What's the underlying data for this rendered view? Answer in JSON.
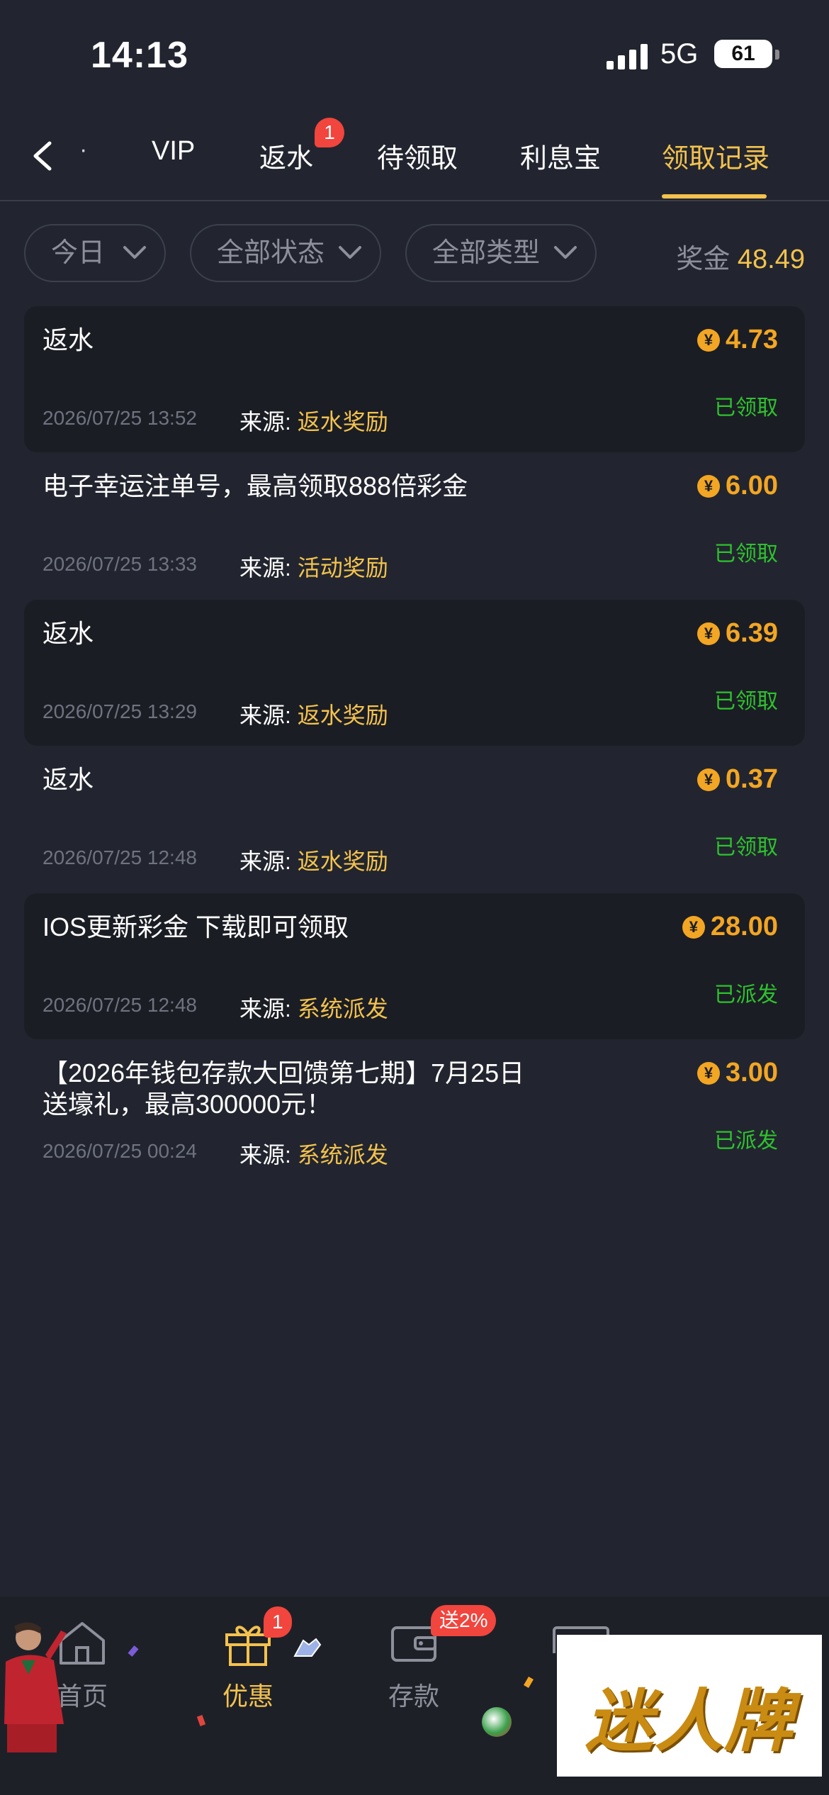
{
  "status_bar": {
    "time": "14:13",
    "network": "5G",
    "battery": "61"
  },
  "tabs": [
    {
      "label": "VIP"
    },
    {
      "label": "返水",
      "badge": "1"
    },
    {
      "label": "待领取"
    },
    {
      "label": "利息宝"
    },
    {
      "label": "领取记录",
      "active": true
    }
  ],
  "filters": {
    "date": "今日",
    "status": "全部状态",
    "type": "全部类型"
  },
  "bonus": {
    "label": "奖金",
    "amount": "48.49"
  },
  "source_label": "来源:",
  "currency_icon": "¥",
  "records": [
    {
      "title": "返水",
      "amount": "4.73",
      "time": "2026/07/25 13:52",
      "source": "返水奖励",
      "status": "已领取"
    },
    {
      "title": "电子幸运注单号，最高领取888倍彩金",
      "amount": "6.00",
      "time": "2026/07/25 13:33",
      "source": "活动奖励",
      "status": "已领取"
    },
    {
      "title": "返水",
      "amount": "6.39",
      "time": "2026/07/25 13:29",
      "source": "返水奖励",
      "status": "已领取"
    },
    {
      "title": "返水",
      "amount": "0.37",
      "time": "2026/07/25 12:48",
      "source": "返水奖励",
      "status": "已领取"
    },
    {
      "title": "IOS更新彩金  下载即可领取",
      "amount": "28.00",
      "time": "2026/07/25 12:48",
      "source": "系统派发",
      "status": "已派发"
    },
    {
      "title": "【2026年钱包存款大回馈第七期】7月25日送壕礼，最高300000元！",
      "amount": "3.00",
      "time": "2026/07/25 00:24",
      "source": "系统派发",
      "status": "已派发"
    }
  ],
  "bottom_nav": {
    "home": "首页",
    "promo": "优惠",
    "promo_badge": "1",
    "deposit": "存款",
    "deposit_badge": "送2%"
  },
  "logo": "迷人牌",
  "colors": {
    "accent": "#f3c24e",
    "amount": "#f3a623",
    "success": "#2ec22e",
    "badge": "#f1453d",
    "background": "#22252f"
  }
}
